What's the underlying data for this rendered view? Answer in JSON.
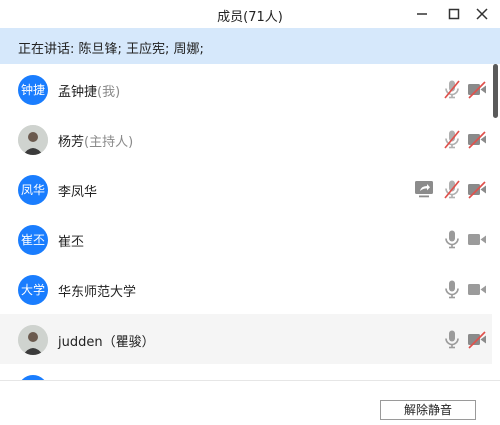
{
  "window": {
    "title": "成员(71人)"
  },
  "speaking": {
    "text": "正在讲话: 陈旦锋; 王应宪; 周娜;"
  },
  "members": [
    {
      "avatar_text": "钟捷",
      "avatar_type": "text",
      "name": "孟钟捷",
      "role": "(我)",
      "share": false,
      "mic": "muted",
      "cam": "off"
    },
    {
      "avatar_text": "",
      "avatar_type": "photo",
      "name": "杨芳",
      "role": "(主持人)",
      "share": false,
      "mic": "muted",
      "cam": "off"
    },
    {
      "avatar_text": "凤华",
      "avatar_type": "text",
      "name": "李凤华",
      "role": "",
      "share": true,
      "mic": "muted",
      "cam": "off"
    },
    {
      "avatar_text": "崔丕",
      "avatar_type": "text",
      "name": "崔丕",
      "role": "",
      "share": false,
      "mic": "on",
      "cam": "on"
    },
    {
      "avatar_text": "大学",
      "avatar_type": "text",
      "name": "华东师范大学",
      "role": "",
      "share": false,
      "mic": "on",
      "cam": "on"
    },
    {
      "avatar_text": "",
      "avatar_type": "photo",
      "name": "judden（瞿骏）",
      "role": "",
      "share": false,
      "mic": "on",
      "cam": "off"
    }
  ],
  "footer": {
    "unmute_label": "解除静音"
  },
  "colors": {
    "accent": "#1a7dfe",
    "muted_red": "#e0504b",
    "icon_gray": "#9b9b9b",
    "speaking_bg": "#d6e8fb"
  }
}
